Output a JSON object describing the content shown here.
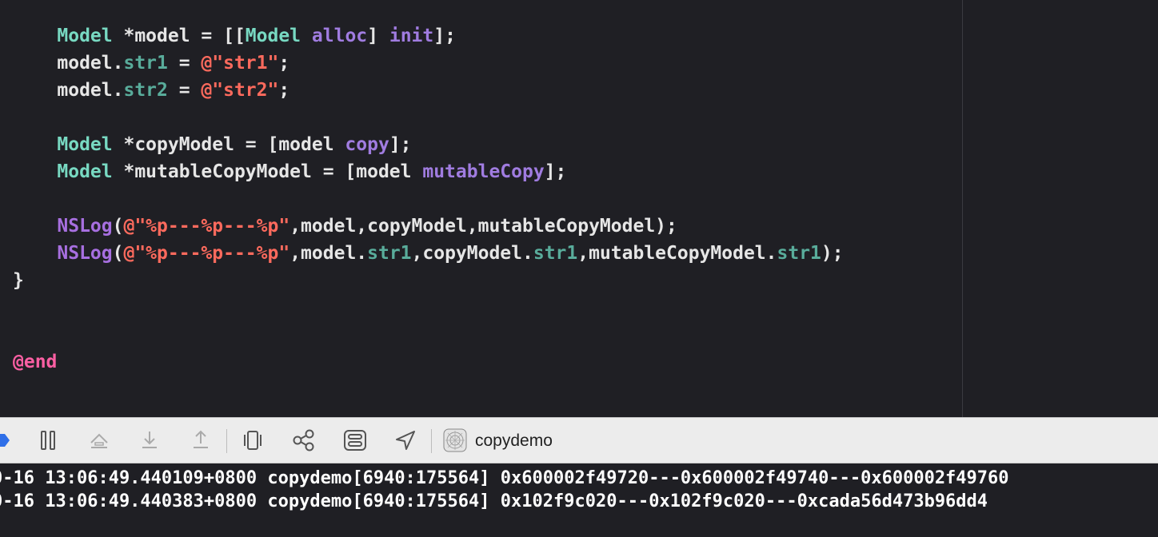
{
  "editor": {
    "lines": [
      {
        "parts": [
          [
            "type",
            "    Model"
          ],
          [
            "plain",
            " *model = [["
          ],
          [
            "type",
            "Model"
          ],
          [
            "plain",
            " "
          ],
          [
            "method",
            "alloc"
          ],
          [
            "plain",
            "] "
          ],
          [
            "method",
            "init"
          ],
          [
            "plain",
            "];"
          ]
        ]
      },
      {
        "parts": [
          [
            "plain",
            "    model."
          ],
          [
            "prop",
            "str1"
          ],
          [
            "plain",
            " = "
          ],
          [
            "str",
            "@\"str1\""
          ],
          [
            "plain",
            ";"
          ]
        ]
      },
      {
        "parts": [
          [
            "plain",
            "    model."
          ],
          [
            "prop",
            "str2"
          ],
          [
            "plain",
            " = "
          ],
          [
            "str",
            "@\"str2\""
          ],
          [
            "plain",
            ";"
          ]
        ]
      },
      {
        "parts": []
      },
      {
        "parts": [
          [
            "type",
            "    Model"
          ],
          [
            "plain",
            " *copyModel = [model "
          ],
          [
            "method",
            "copy"
          ],
          [
            "plain",
            "];"
          ]
        ]
      },
      {
        "parts": [
          [
            "type",
            "    Model"
          ],
          [
            "plain",
            " *mutableCopyModel = [model "
          ],
          [
            "method",
            "mutableCopy"
          ],
          [
            "plain",
            "];"
          ]
        ]
      },
      {
        "parts": []
      },
      {
        "parts": [
          [
            "fn",
            "    NSLog"
          ],
          [
            "plain",
            "("
          ],
          [
            "str",
            "@\"%p---%p---%p\""
          ],
          [
            "plain",
            ",model,copyModel,mutableCopyModel);"
          ]
        ]
      },
      {
        "parts": [
          [
            "fn",
            "    NSLog"
          ],
          [
            "plain",
            "("
          ],
          [
            "str",
            "@\"%p---%p---%p\""
          ],
          [
            "plain",
            ",model."
          ],
          [
            "prop",
            "str1"
          ],
          [
            "plain",
            ",copyModel."
          ],
          [
            "prop",
            "str1"
          ],
          [
            "plain",
            ",mutableCopyModel."
          ],
          [
            "prop",
            "str1"
          ],
          [
            "plain",
            ");"
          ]
        ]
      },
      {
        "parts": [
          [
            "plain",
            "}"
          ]
        ]
      },
      {
        "parts": []
      },
      {
        "parts": []
      },
      {
        "parts": [
          [
            "kw",
            "@end"
          ]
        ]
      }
    ]
  },
  "debug_bar": {
    "buttons": [
      {
        "name": "breakpoints-toggle-icon"
      },
      {
        "name": "pause-icon"
      },
      {
        "name": "step-over-icon"
      },
      {
        "name": "step-into-icon"
      },
      {
        "name": "step-out-icon"
      },
      {
        "name": "view-hierarchy-icon"
      },
      {
        "name": "memory-graph-icon"
      },
      {
        "name": "environment-overrides-icon"
      },
      {
        "name": "simulate-location-icon"
      },
      {
        "name": "app-target-icon"
      }
    ],
    "target_label": "copydemo"
  },
  "console": {
    "lines": [
      "0-16 13:06:49.440109+0800 copydemo[6940:175564] 0x600002f49720---0x600002f49740---0x600002f49760",
      "0-16 13:06:49.440383+0800 copydemo[6940:175564] 0x102f9c020---0x102f9c020---0xcada56d473b96dd4"
    ]
  },
  "colors": {
    "editor_bg": "#1f1f24",
    "type": "#78d9c2",
    "method": "#a07ce0",
    "property": "#59ac9b",
    "string": "#fc6a5d",
    "keyword": "#fc5fa3",
    "debug_bar_bg": "#ececec",
    "breakpoint_blue": "#2f6fe8"
  }
}
